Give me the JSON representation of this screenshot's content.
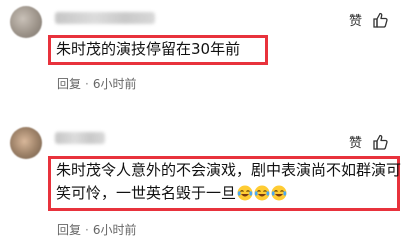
{
  "comments": [
    {
      "text": "朱时茂的演技停留在30年前",
      "reply_label": "回复",
      "time": "6小时前",
      "like_label": "赞"
    },
    {
      "text_line1": "朱时茂令人意外的不会演戏，剧中表演尚不如群演可",
      "text_line2": "笑可怜，一世英名毁于一旦",
      "emoji_icons": [
        "crying-laughing-emoji",
        "crying-laughing-emoji",
        "crying-laughing-emoji"
      ],
      "reply_label": "回复",
      "time": "6小时前",
      "like_label": "赞"
    }
  ],
  "colors": {
    "highlight": "#e8323c",
    "meta": "#666666"
  }
}
